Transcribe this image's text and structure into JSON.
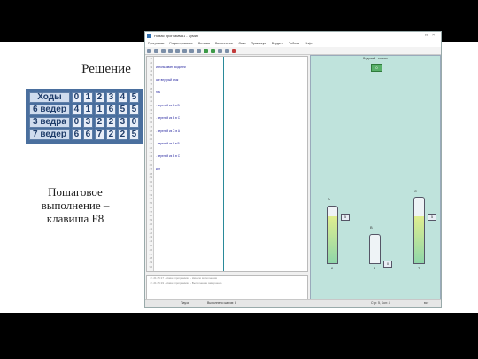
{
  "slide": {
    "heading": "Решение",
    "caption_lines": [
      "Пошаговое",
      "выполнение –",
      "клавиша F8"
    ]
  },
  "moves_table": {
    "header_label": "Ходы",
    "steps": [
      "0",
      "1",
      "2",
      "3",
      "4",
      "5"
    ],
    "rows": [
      {
        "label": "6 ведер",
        "values": [
          "4",
          "1",
          "1",
          "6",
          "5",
          "5"
        ]
      },
      {
        "label": "3 ведра",
        "values": [
          "0",
          "3",
          "2",
          "2",
          "3",
          "0"
        ]
      },
      {
        "label": "7 ведер",
        "values": [
          "6",
          "6",
          "7",
          "2",
          "2",
          "5"
        ]
      }
    ]
  },
  "app": {
    "title": "Новая программа1 - Кумир",
    "menu": [
      "Программа",
      "Редактирование",
      "Вставка",
      "Выполнение",
      "Окна",
      "Практикум",
      "Вердикт",
      "Роботы",
      "Инфо"
    ],
    "code_lines": [
      "использовать Водолей",
      "алг внутрый знак",
      "нач",
      ". перелей из A в B",
      ". перелей из B в C",
      ". перелей из C в A",
      ". перелей из A в B",
      ". перелей из B в C",
      "кон"
    ],
    "line_count": 50,
    "output_lines": [
      ">> 21:45:17 - Новая программа1 - Начало выполнения",
      ">> 21:45:19 - Новая программа1 - Выполнение завершено"
    ],
    "status": {
      "mode": "Пауза",
      "steps": "Выполнено шагов: 5",
      "position": "Стр: 5, Кол: 4",
      "insert": "вст"
    }
  },
  "robot": {
    "title": "Водолей - можно",
    "button": "0",
    "vessels": [
      {
        "name": "A",
        "capacity": "6",
        "amount": "5",
        "level": 0.83
      },
      {
        "name": "B",
        "capacity": "3",
        "amount": "0",
        "level": 0.0
      },
      {
        "name": "C",
        "capacity": "7",
        "amount": "5",
        "level": 0.71
      }
    ]
  }
}
